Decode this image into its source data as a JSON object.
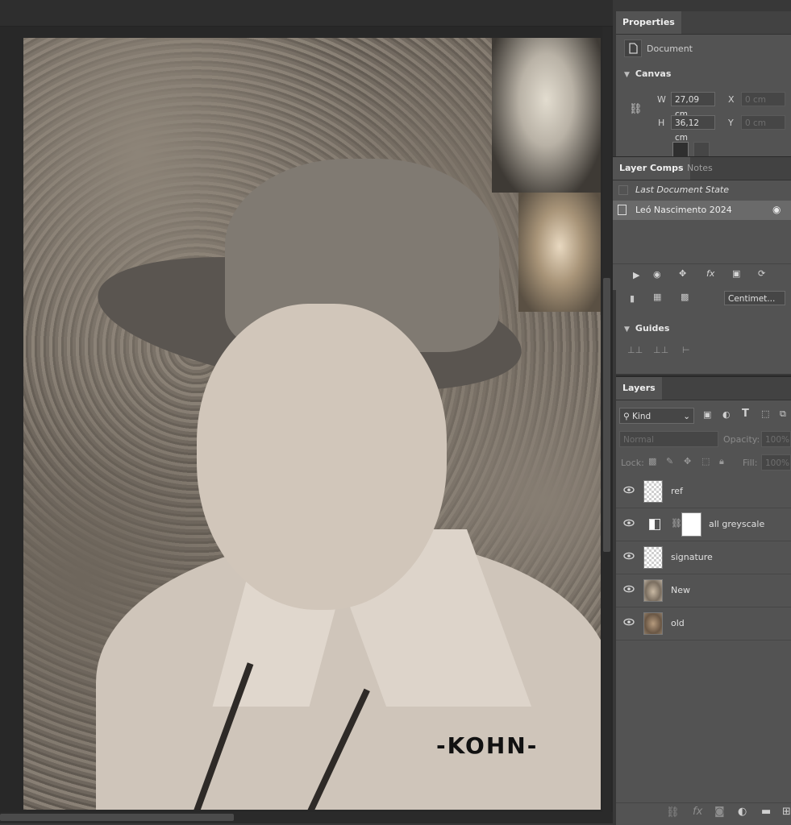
{
  "colors": {
    "panel_bg": "#535353",
    "tab_bg": "#424242",
    "canvas_bg": "#282828"
  },
  "properties": {
    "tab": "Properties",
    "doc_label": "Document",
    "canvas_label": "Canvas",
    "w_label": "W",
    "w_value": "27,09 cm",
    "h_label": "H",
    "h_value": "36,12 cm",
    "x_label": "X",
    "x_placeholder": "0 cm",
    "y_label": "Y",
    "y_placeholder": "0 cm",
    "units_value": "Centimet...",
    "guides_label": "Guides"
  },
  "layer_comps": {
    "tabs": [
      "Layer Comps",
      "Notes"
    ],
    "items": [
      "Last Document State",
      "Leó Nascimento 2024"
    ]
  },
  "layers": {
    "tab": "Layers",
    "filter_kind": "Kind",
    "blend_mode": "Normal",
    "opacity_label": "Opacity:",
    "opacity_value": "100%",
    "lock_label": "Lock:",
    "fill_label": "Fill:",
    "fill_value": "100%",
    "items": [
      {
        "name": "ref",
        "type": "pixel-transparent"
      },
      {
        "name": "all greyscale",
        "type": "adjustment"
      },
      {
        "name": "signature",
        "type": "pixel-transparent"
      },
      {
        "name": "New",
        "type": "photo"
      },
      {
        "name": "old",
        "type": "photo"
      }
    ]
  },
  "canvas": {
    "signature_text": "-KOHN-"
  }
}
